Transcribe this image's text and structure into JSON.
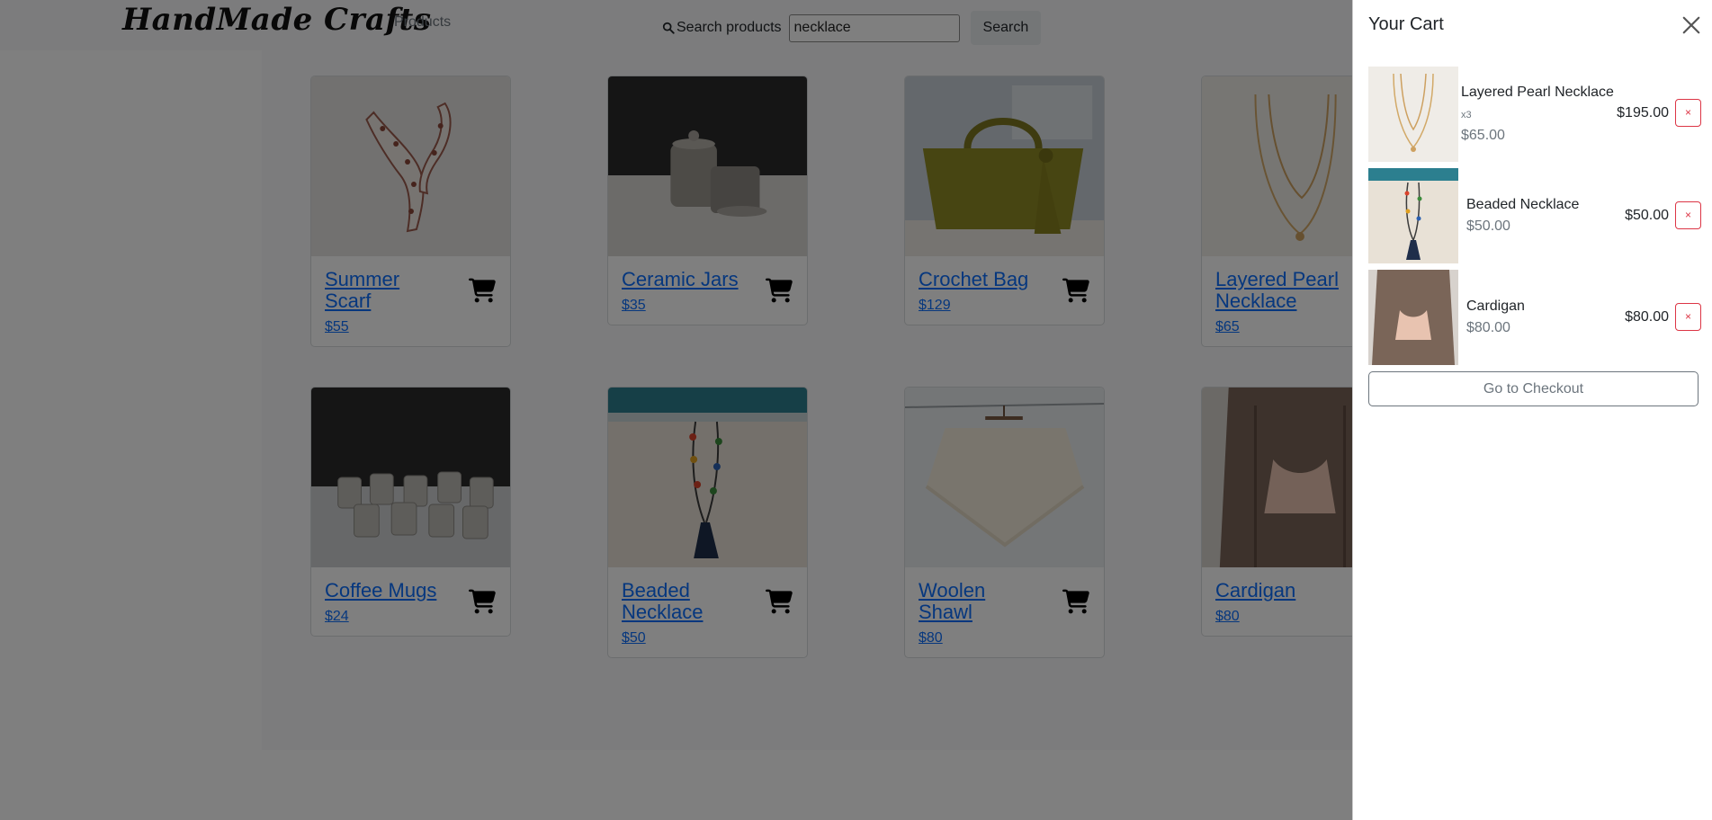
{
  "header": {
    "brand": "HandMade Crafts",
    "nav_products": "Products",
    "search_label": "Search products",
    "search_value": "necklace",
    "search_button": "Search"
  },
  "products": [
    {
      "name": "Summer Scarf",
      "price": "$55"
    },
    {
      "name": "Ceramic Jars",
      "price": "$35"
    },
    {
      "name": "Crochet Bag",
      "price": "$129"
    },
    {
      "name": "Layered Pearl Necklace",
      "price": "$65"
    },
    {
      "name": "Coffee Mugs",
      "price": "$24"
    },
    {
      "name": "Beaded Necklace",
      "price": "$50"
    },
    {
      "name": "Woolen Shawl",
      "price": "$80"
    },
    {
      "name": "Cardigan",
      "price": "$80"
    }
  ],
  "cart": {
    "title": "Your Cart",
    "items": [
      {
        "name": "Layered Pearl Necklace",
        "qty": "x3",
        "unit_price": "$65.00",
        "total": "$195.00",
        "remove": "×"
      },
      {
        "name": "Beaded Necklace",
        "unit_price": "$50.00",
        "total": "$50.00",
        "remove": "×"
      },
      {
        "name": "Cardigan",
        "unit_price": "$80.00",
        "total": "$80.00",
        "remove": "×"
      }
    ],
    "checkout": "Go to Checkout"
  },
  "icons": {
    "search": "search-icon",
    "cart": "shopping-cart-icon",
    "close": "close-icon"
  },
  "colors": {
    "link": "#0d6efd",
    "remove": "#dc3545",
    "overlay": "rgba(0,0,0,0.5)"
  }
}
